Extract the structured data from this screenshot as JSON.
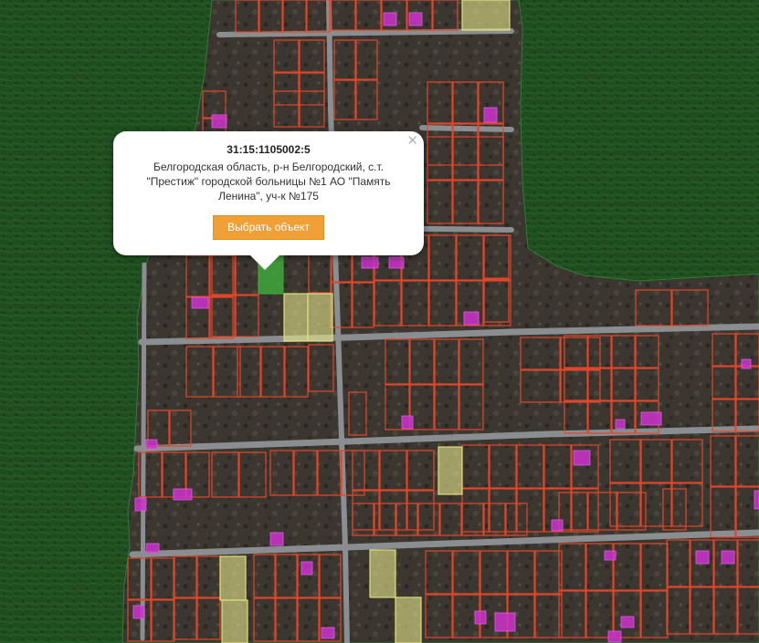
{
  "popup": {
    "cadastral_number": "31:15:1105002:5",
    "address": "Белгородская область, р-н Белгородский, с.т. \"Престиж\" городской больницы №1 АО \"Память Ленина\", уч-к №175",
    "select_button_label": "Выбрать объект",
    "close_icon": "close-icon"
  },
  "colors": {
    "forest": "#1f4d1f",
    "settlement": "#3b3630",
    "road": "#8a8e90",
    "parcel_outline": "#e0472a",
    "building_highlight": "#cc33cc",
    "parcel_yellow": "#e6e68a",
    "parcel_green_selected": "#3ea83a",
    "button": "#f0a035"
  }
}
